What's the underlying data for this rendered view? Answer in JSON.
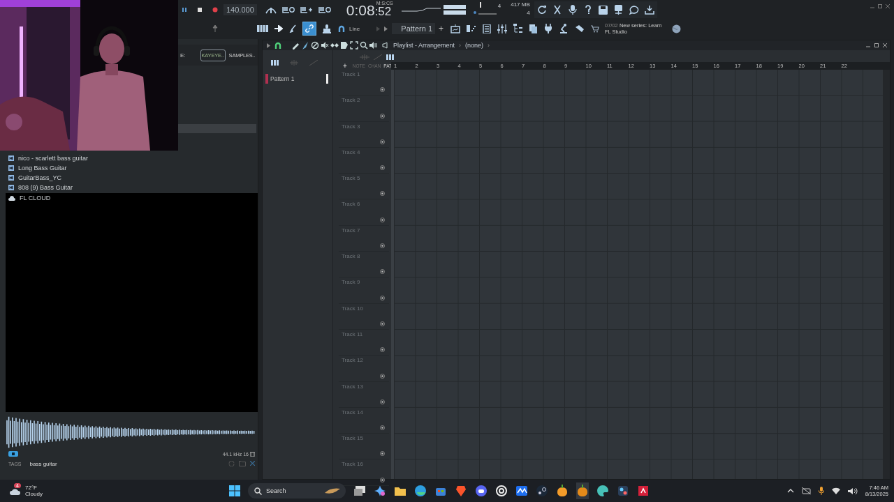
{
  "transport": {
    "tempo": "140.000",
    "time_main": "0:08",
    "time_sub": ":52",
    "time_unit": "M:S:CS",
    "readouts": [
      "4",
      "417 MB",
      "4"
    ],
    "record_armed": true
  },
  "toolbar": {
    "link_mode_on": true,
    "snap": "Line",
    "pattern": "Pattern 1",
    "pattern_add": "+",
    "news_date": "07/02",
    "news_text": "New series: Learn FL Studio"
  },
  "browser": {
    "path": "E:",
    "tabs": [
      {
        "label": "KAYEYE..",
        "selected": true
      },
      {
        "label": "SAMPLES..",
        "selected": false
      }
    ],
    "items": [
      {
        "kind": "file",
        "label": "nico - scarlett bass guitar"
      },
      {
        "kind": "file",
        "label": "Long Bass Guitar"
      },
      {
        "kind": "file",
        "label": "GuitarBass_YC"
      },
      {
        "kind": "file",
        "label": "808 (9) Bass Guitar"
      },
      {
        "kind": "cloud",
        "label": "FL CLOUD"
      }
    ],
    "sample_info": "44.1 kHz 16",
    "tags_label": "TAGS",
    "tags": "bass guitar"
  },
  "playlist": {
    "crumbs": [
      {
        "text": "Playlist - Arrangement",
        "sep": "›"
      },
      {
        "text": "(none)",
        "sep": "›"
      }
    ],
    "add": "+",
    "columns": [
      "NOTE",
      "CHAN",
      "PAT"
    ],
    "patterns": [
      {
        "label": "Pattern 1",
        "selected": true
      }
    ],
    "bars": [
      "1",
      "2",
      "3",
      "4",
      "5",
      "6",
      "7",
      "8",
      "9",
      "10",
      "11",
      "12",
      "13",
      "14",
      "15",
      "16",
      "17",
      "18",
      "19",
      "20",
      "21",
      "22"
    ],
    "tracks": [
      "Track 1",
      "Track 2",
      "Track 3",
      "Track 4",
      "Track 5",
      "Track 6",
      "Track 7",
      "Track 8",
      "Track 9",
      "Track 10",
      "Track 11",
      "Track 12",
      "Track 13",
      "Track 14",
      "Track 15",
      "Track 16"
    ]
  },
  "taskbar": {
    "badge": "4",
    "temperature": "72°F",
    "condition": "Cloudy",
    "search_placeholder": "Search",
    "time": "7:46 AM",
    "date": "8/13/2025"
  }
}
